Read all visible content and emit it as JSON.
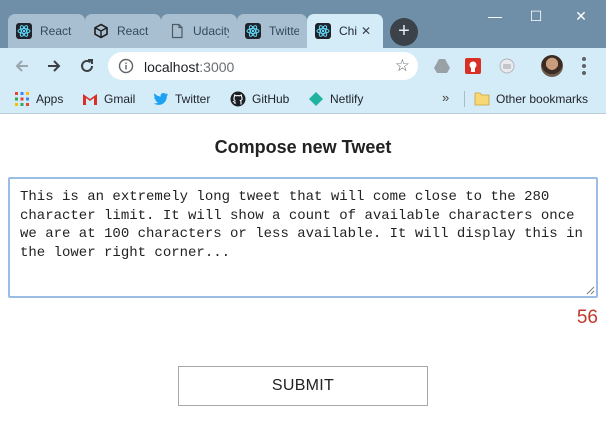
{
  "browser": {
    "tabs": [
      {
        "title": "React",
        "icon": "react-icon",
        "active": false
      },
      {
        "title": "React",
        "icon": "codesandbox-icon",
        "active": false
      },
      {
        "title": "Udacity",
        "icon": "document-icon",
        "active": false
      },
      {
        "title": "Twitter",
        "icon": "react-icon",
        "active": false
      },
      {
        "title": "Chirper",
        "icon": "react-icon",
        "active": true
      }
    ],
    "new_tab_label": "+",
    "window_controls": {
      "minimize": "—",
      "maximize": "☐",
      "close": "✕"
    },
    "address": {
      "host": "localhost",
      "port": ":3000"
    },
    "bookmarks": [
      {
        "label": "Apps",
        "icon": "apps-grid-icon"
      },
      {
        "label": "Gmail",
        "icon": "gmail-icon"
      },
      {
        "label": "Twitter",
        "icon": "twitter-icon"
      },
      {
        "label": "GitHub",
        "icon": "github-icon"
      },
      {
        "label": "Netlify",
        "icon": "netlify-icon"
      }
    ],
    "bookmarks_overflow": "»",
    "other_bookmarks": "Other bookmarks"
  },
  "page": {
    "heading": "Compose new Tweet",
    "tweet_text": "This is an extremely long tweet that will come close to the 280 character limit. It will show a count of available characters once we are at 100 characters or less available. It will display this in the lower right corner...",
    "chars_remaining": "56",
    "submit_label": "SUBMIT"
  },
  "colors": {
    "tab_strip": "#6f8fa8",
    "toolbar": "#d4ebf8",
    "counter": "#c0392b",
    "textarea_border": "#9bbce3"
  }
}
